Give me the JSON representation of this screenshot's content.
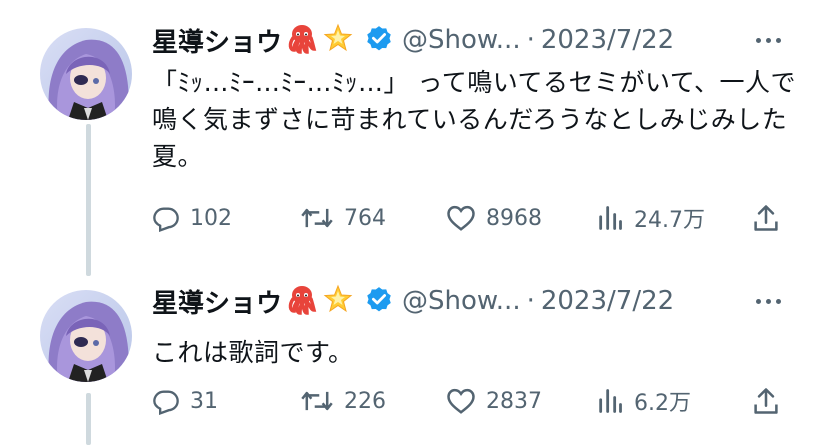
{
  "tweets": [
    {
      "author_name": "星導ショウ",
      "handle": "@Show...",
      "separator": "·",
      "date": "2023/7/22",
      "text": "「ﾐｯ…ﾐｰ…ﾐｰ…ﾐｯ…」 って鳴いてるセミがいて、一人で鳴く気まずさに苛まれているんだろうなとしみじみした夏。",
      "replies": "102",
      "retweets": "764",
      "likes": "8968",
      "views": "24.7万"
    },
    {
      "author_name": "星導ショウ",
      "handle": "@Show...",
      "separator": "·",
      "date": "2023/7/22",
      "text": "これは歌詞です。",
      "replies": "31",
      "retweets": "226",
      "likes": "2837",
      "views": "6.2万"
    }
  ],
  "icons": {
    "emoji_1": "octopus-icon",
    "emoji_2": "glowing-star-icon",
    "verified": "verified-badge-icon",
    "more": "more-icon",
    "reply": "reply-icon",
    "retweet": "retweet-icon",
    "like": "like-icon",
    "views": "views-icon",
    "share": "share-icon"
  },
  "colors": {
    "verified": "#1d9bf0",
    "text": "#0f1419",
    "muted": "#536471",
    "thread_line": "#cfd9de"
  }
}
